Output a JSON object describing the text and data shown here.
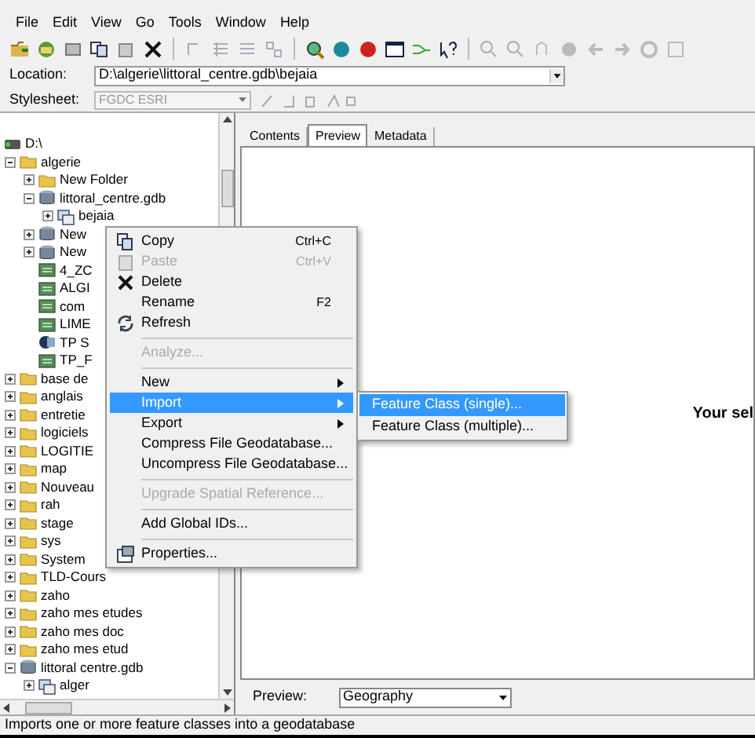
{
  "menu_bar": [
    {
      "label": "File"
    },
    {
      "label": "Edit"
    },
    {
      "label": "View"
    },
    {
      "label": "Go"
    },
    {
      "label": "Tools"
    },
    {
      "label": "Window"
    },
    {
      "label": "Help"
    }
  ],
  "location": {
    "label": "Location:",
    "value": "D:\\algerie\\littoral_centre.gdb\\bejaia"
  },
  "stylesheet": {
    "label": "Stylesheet:",
    "value": "FGDC ESRI",
    "disabled": true
  },
  "tree": [
    {
      "label": "D:\\",
      "kind": "drive",
      "children": [
        {
          "label": "algerie",
          "kind": "folder",
          "expanded": true,
          "children": [
            {
              "label": "New Folder",
              "kind": "folder",
              "expanded": false
            },
            {
              "label": "littoral_centre.gdb",
              "kind": "geodatabase",
              "expanded": true,
              "children": [
                {
                  "label": "bejaia",
                  "kind": "feature_dataset",
                  "expanded": false
                }
              ]
            },
            {
              "label": "New",
              "kind": "geodatabase",
              "expanded": false
            },
            {
              "label": "New",
              "kind": "geodatabase",
              "expanded": false
            },
            {
              "label": "4_ZC",
              "kind": "feature_class"
            },
            {
              "label": "ALGI",
              "kind": "feature_class"
            },
            {
              "label": "com",
              "kind": "feature_class"
            },
            {
              "label": "LIME",
              "kind": "feature_class"
            },
            {
              "label": "TP S",
              "kind": "topology"
            },
            {
              "label": "TP_F",
              "kind": "feature_class"
            }
          ]
        },
        {
          "label": "base de",
          "kind": "folder",
          "expanded": false
        },
        {
          "label": "anglais",
          "kind": "folder",
          "expanded": false
        },
        {
          "label": "entretie",
          "kind": "folder",
          "expanded": false
        },
        {
          "label": "logiciels",
          "kind": "folder",
          "expanded": false
        },
        {
          "label": "LOGITIE",
          "kind": "folder",
          "expanded": false
        },
        {
          "label": "map",
          "kind": "folder",
          "expanded": false
        },
        {
          "label": "Nouveau",
          "kind": "folder",
          "expanded": false
        },
        {
          "label": "rah",
          "kind": "folder",
          "expanded": false
        },
        {
          "label": "stage",
          "kind": "folder",
          "expanded": false
        },
        {
          "label": "sys",
          "kind": "folder",
          "expanded": false
        },
        {
          "label": "System",
          "kind": "folder",
          "expanded": false
        },
        {
          "label": "TLD-Cours",
          "kind": "folder",
          "expanded": false
        },
        {
          "label": "zaho",
          "kind": "folder",
          "expanded": false
        },
        {
          "label": "zaho  mes etudes",
          "kind": "folder",
          "expanded": false
        },
        {
          "label": "zaho mes doc",
          "kind": "folder",
          "expanded": false
        },
        {
          "label": "zaho mes etud",
          "kind": "folder",
          "expanded": false
        },
        {
          "label": "littoral centre.gdb",
          "kind": "geodatabase",
          "expanded": true,
          "children": [
            {
              "label": "alger",
              "kind": "feature_dataset",
              "expanded": false
            }
          ]
        }
      ]
    }
  ],
  "tabs": [
    {
      "label": "Contents",
      "selected": false
    },
    {
      "label": "Preview",
      "selected": true
    },
    {
      "label": "Metadata",
      "selected": false
    }
  ],
  "preview_message": "Your sel",
  "preview_bar": {
    "label": "Preview:",
    "value": "Geography"
  },
  "context_menu": [
    {
      "kind": "command",
      "label": "Copy",
      "shortcut": "Ctrl+C",
      "disabled": false,
      "submenu": false,
      "selected": false
    },
    {
      "kind": "command",
      "label": "Paste",
      "shortcut": "Ctrl+V",
      "disabled": true,
      "submenu": false,
      "selected": false
    },
    {
      "kind": "command",
      "label": "Delete",
      "disabled": false,
      "submenu": false,
      "selected": false
    },
    {
      "kind": "command",
      "label": "Rename",
      "shortcut": "F2",
      "disabled": false,
      "submenu": false,
      "selected": false
    },
    {
      "kind": "command",
      "label": "Refresh",
      "disabled": false,
      "submenu": false,
      "selected": false
    },
    {
      "kind": "separator"
    },
    {
      "kind": "command",
      "label": "Analyze...",
      "disabled": true,
      "submenu": false,
      "selected": false
    },
    {
      "kind": "separator"
    },
    {
      "kind": "command",
      "label": "New",
      "disabled": false,
      "submenu": true,
      "selected": false
    },
    {
      "kind": "command",
      "label": "Import",
      "disabled": false,
      "submenu": true,
      "selected": true
    },
    {
      "kind": "command",
      "label": "Export",
      "disabled": false,
      "submenu": true,
      "selected": false
    },
    {
      "kind": "command",
      "label": "Compress File Geodatabase...",
      "disabled": false,
      "submenu": false,
      "selected": false
    },
    {
      "kind": "command",
      "label": "Uncompress File Geodatabase...",
      "disabled": false,
      "submenu": false,
      "selected": false
    },
    {
      "kind": "separator"
    },
    {
      "kind": "command",
      "label": "Upgrade Spatial Reference...",
      "disabled": true,
      "submenu": false,
      "selected": false
    },
    {
      "kind": "separator"
    },
    {
      "kind": "command",
      "label": "Add Global IDs...",
      "disabled": false,
      "submenu": false,
      "selected": false
    },
    {
      "kind": "separator"
    },
    {
      "kind": "command",
      "label": "Properties...",
      "disabled": false,
      "submenu": false,
      "selected": false
    }
  ],
  "import_submenu": [
    {
      "label": "Feature Class (single)...",
      "selected": true
    },
    {
      "label": "Feature Class (multiple)...",
      "selected": false
    }
  ],
  "status_bar": "Imports one or more feature classes into a geodatabase"
}
